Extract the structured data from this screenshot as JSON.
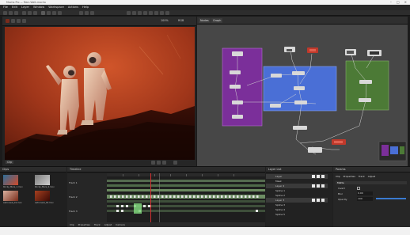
{
  "titlebar": {
    "title": "Mocha Pro — Mars Walk.mocha"
  },
  "menubar": {
    "items": [
      "File",
      "Edit",
      "Layer",
      "Window",
      "Workspace",
      "Actions",
      "Help"
    ]
  },
  "viewer": {
    "zoom_label": "100%",
    "channel_label": "RGB",
    "footer_view": "Clip"
  },
  "node_panel": {
    "tabs": [
      "Nodes",
      "Graph"
    ],
    "node_labels": [
      "Read",
      "Merge",
      "Grade",
      "Blur",
      "Track",
      "Output"
    ]
  },
  "clips_panel": {
    "title": "Clips",
    "clips": [
      {
        "name": "Rocky_Mars_1.mov"
      },
      {
        "name": "Rocky_Mars_2.mov"
      },
      {
        "name": "Astronaut_01.mov"
      },
      {
        "name": "Astronaut_02.mov"
      }
    ]
  },
  "timeline_panel": {
    "title": "Timeline",
    "tracks": [
      "Track 1",
      "Track 2",
      "Track 3"
    ]
  },
  "layers_panel": {
    "title": "Layer List",
    "layers": [
      "Layer",
      "Mask",
      "Layer 2",
      "Spline 1",
      "Spline 2",
      "Layer 3",
      "Spline 3",
      "Spline 4",
      "Spline 5"
    ]
  },
  "params_panel": {
    "title": "Params",
    "tabs": [
      "Clip",
      "Properties",
      "Track",
      "Adjust"
    ],
    "section_label": "Matte",
    "fields": [
      {
        "label": "Invert",
        "value": ""
      },
      {
        "label": "Blur",
        "value": "0.00"
      },
      {
        "label": "Opacity",
        "value": "100"
      }
    ]
  },
  "bottom_tabs": [
    "Clip",
    "Properties",
    "Track",
    "Adjust",
    "Camera"
  ],
  "colors": {
    "accent_blue": "#4a6fd6",
    "node_purple": "#7b2f9a",
    "node_green": "#4c7a36",
    "viewer_bg": "#8f2a12",
    "panel_bg": "#202020"
  }
}
